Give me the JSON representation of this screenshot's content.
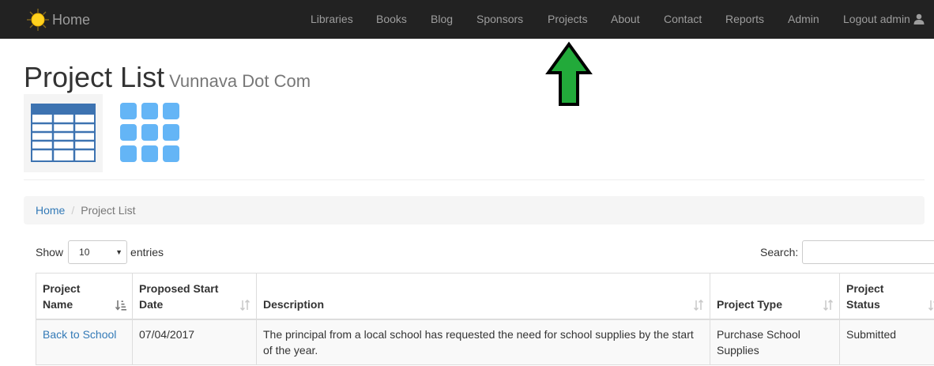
{
  "navbar": {
    "brand_label": "Home",
    "links": [
      "Libraries",
      "Books",
      "Blog",
      "Sponsors",
      "Projects",
      "About",
      "Contact",
      "Reports",
      "Admin"
    ],
    "logout_label": "Logout admin",
    "background": "#222222",
    "link_color": "#9d9d9d"
  },
  "header": {
    "title": "Project List",
    "subtitle": "Vunnava Dot Com"
  },
  "view_toggles": {
    "table_icon": "table-view-icon",
    "grid_icon": "grid-view-icon",
    "table_color": "#3d73b1",
    "grid_color": "#64b5f6"
  },
  "breadcrumb": {
    "home": "Home",
    "separator": "/",
    "current": "Project List"
  },
  "length": {
    "prefix": "Show",
    "value": "10",
    "suffix": "entries"
  },
  "search": {
    "label": "Search:",
    "value": ""
  },
  "table": {
    "columns": [
      {
        "line1": "Project",
        "line2": "Name",
        "sort": "ascending"
      },
      {
        "line1": "Proposed Start",
        "line2": "Date",
        "sort": "none"
      },
      {
        "line1": "",
        "line2": "Description",
        "sort": "none"
      },
      {
        "line1": "",
        "line2": "Project Type",
        "sort": "none"
      },
      {
        "line1": "Project",
        "line2": "Status",
        "sort": "none"
      }
    ],
    "rows": [
      {
        "name": "Back to School",
        "start_date": "07/04/2017",
        "description": "The principal from a local school has requested the need for school supplies by the start of the year.",
        "type": "Purchase School Supplies",
        "status": "Submitted"
      }
    ]
  },
  "annotation": {
    "arrow_color": "#22aa3a",
    "points_to": "Projects"
  },
  "colors": {
    "link": "#337ab7",
    "breadcrumb_bg": "#f5f5f5",
    "striped_row": "#f9f9f9"
  }
}
